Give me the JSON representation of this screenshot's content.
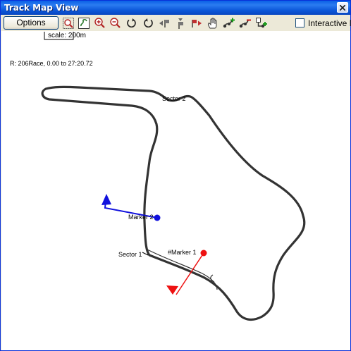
{
  "window": {
    "title": "Track Map View",
    "close_icon": "close-icon"
  },
  "toolbar": {
    "options_label": "Options",
    "icons": [
      "zoom-window-icon",
      "zoom-fit-icon",
      "zoom-in-icon",
      "zoom-out-icon",
      "rotate-clockwise-icon",
      "rotate-counterclockwise-icon",
      "flag-left-icon",
      "flag-down-icon",
      "flag-right-icon",
      "hand-pan-icon",
      "add-marker-icon",
      "remove-marker-icon",
      "marker-settings-icon"
    ],
    "interactive_label": "Interactive M"
  },
  "map": {
    "scale_label": "scale: 200m",
    "info_text": "R: 206Race, 0.00 to 27:20.72",
    "labels": {
      "sector2": "Sector 2",
      "sector1": "Sector 1",
      "marker2": "Marker 2",
      "marker1": "#Marker 1"
    },
    "colors": {
      "track": "#333333",
      "marker1": "#ee1111",
      "marker2": "#1111dd",
      "title_bar": "#0a5fe6"
    }
  }
}
